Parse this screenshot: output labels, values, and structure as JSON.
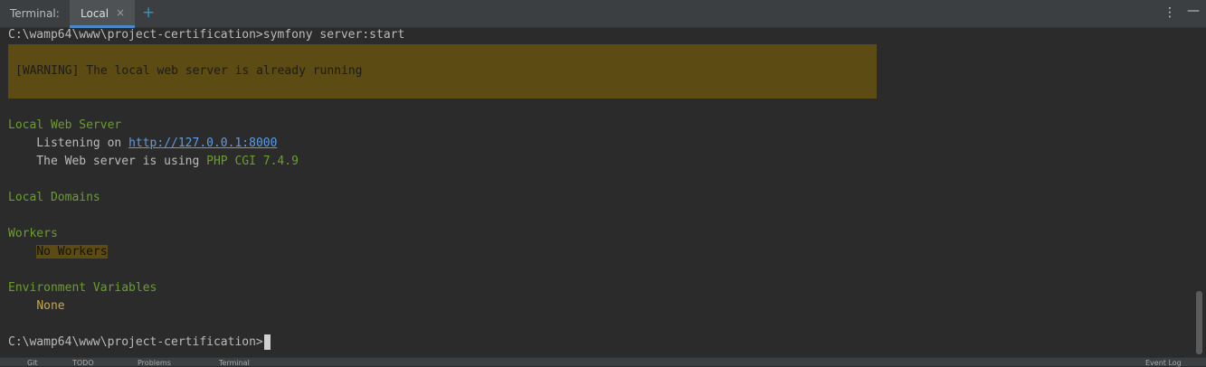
{
  "tabbar": {
    "label": "Terminal:",
    "tab_label": "Local",
    "close_icon": "×",
    "add_icon": "+",
    "menu_icon": "⋮",
    "minimize_icon": "—"
  },
  "terminal": {
    "command_line": "C:\\wamp64\\www\\project-certification>symfony server:start",
    "warning": "[WARNING] The local web server is already running",
    "web_server_heading": "Local Web Server",
    "listening_prefix": "    Listening on ",
    "listening_url": "http://127.0.0.1:8000",
    "using_prefix": "    The Web server is using ",
    "php_version": "PHP CGI 7.4.9",
    "domains_heading": "Local Domains",
    "workers_heading": "Workers",
    "workers_value": "No Workers",
    "env_heading": "Environment Variables",
    "env_value": "None",
    "prompt": "C:\\wamp64\\www\\project-certification>"
  },
  "statusbar": {
    "git": "Git",
    "todo": "TODO",
    "problems": "Problems",
    "terminal": "Terminal",
    "event": "Event Log"
  },
  "colors": {
    "background": "#2b2b2b",
    "warning_bg": "#5c4b12",
    "heading_green": "#6a9e2a",
    "link_blue": "#5c9ce6"
  }
}
